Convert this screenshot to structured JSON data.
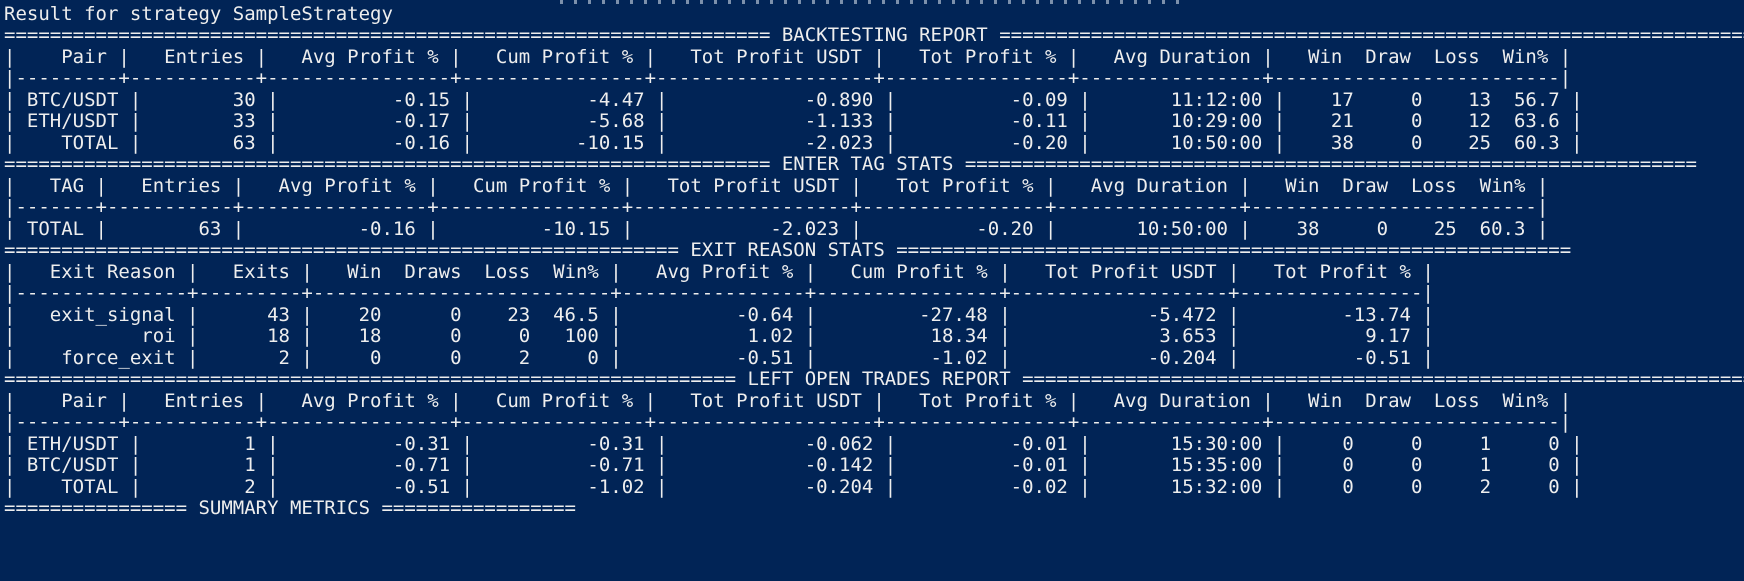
{
  "header": "Result for strategy SampleStrategy",
  "sections": [
    {
      "title_line": "=================================================================== BACKTESTING REPORT ===================================================================",
      "header_line": "|    Pair |   Entries |   Avg Profit % |   Cum Profit % |   Tot Profit USDT |   Tot Profit % |   Avg Duration |   Win  Draw  Loss  Win% |",
      "sep_line": "|---------+-----------+----------------+----------------+-------------------+----------------+----------------+-------------------------|",
      "rows": [
        "| BTC/USDT |        30 |          -0.15 |          -4.47 |            -0.890 |          -0.09 |       11:12:00 |    17     0    13  56.7 |",
        "| ETH/USDT |        33 |          -0.17 |          -5.68 |            -1.133 |          -0.11 |       10:29:00 |    21     0    12  63.6 |",
        "|    TOTAL |        63 |          -0.16 |         -10.15 |            -2.023 |          -0.20 |       10:50:00 |    38     0    25  60.3 |"
      ]
    },
    {
      "title_line": "=================================================================== ENTER TAG STATS ================================================================",
      "header_line": "|   TAG |   Entries |   Avg Profit % |   Cum Profit % |   Tot Profit USDT |   Tot Profit % |   Avg Duration |   Win  Draw  Loss  Win% |",
      "sep_line": "|-------+-----------+----------------+----------------+-------------------+----------------+----------------+-------------------------|",
      "rows": [
        "| TOTAL |        63 |          -0.16 |         -10.15 |            -2.023 |          -0.20 |       10:50:00 |    38     0    25  60.3 |"
      ]
    },
    {
      "title_line": "=========================================================== EXIT REASON STATS ===========================================================",
      "header_line": "|   Exit Reason |   Exits |   Win  Draws  Loss  Win% |   Avg Profit % |   Cum Profit % |   Tot Profit USDT |   Tot Profit % |",
      "sep_line": "|---------------+---------+--------------------------+----------------+----------------+-------------------+----------------|",
      "rows": [
        "|   exit_signal |      43 |    20      0    23  46.5 |          -0.64 |         -27.48 |            -5.472 |         -13.74 |",
        "|           roi |      18 |    18      0     0   100 |           1.02 |          18.34 |             3.653 |           9.17 |",
        "|    force_exit |       2 |     0      0     2     0 |          -0.51 |          -1.02 |            -0.204 |          -0.51 |"
      ]
    },
    {
      "title_line": "================================================================ LEFT OPEN TRADES REPORT ================================================================",
      "header_line": "|    Pair |   Entries |   Avg Profit % |   Cum Profit % |   Tot Profit USDT |   Tot Profit % |   Avg Duration |   Win  Draw  Loss  Win% |",
      "sep_line": "|---------+-----------+----------------+----------------+-------------------+----------------+----------------+-------------------------|",
      "rows": [
        "| ETH/USDT |         1 |          -0.31 |          -0.31 |            -0.062 |          -0.01 |       15:30:00 |     0     0     1     0 |",
        "| BTC/USDT |         1 |          -0.71 |          -0.71 |            -0.142 |          -0.01 |       15:35:00 |     0     0     1     0 |",
        "|    TOTAL |         2 |          -0.51 |          -1.02 |            -0.204 |          -0.02 |       15:32:00 |     0     0     2     0 |"
      ]
    }
  ],
  "footer": "================ SUMMARY METRICS ================="
}
